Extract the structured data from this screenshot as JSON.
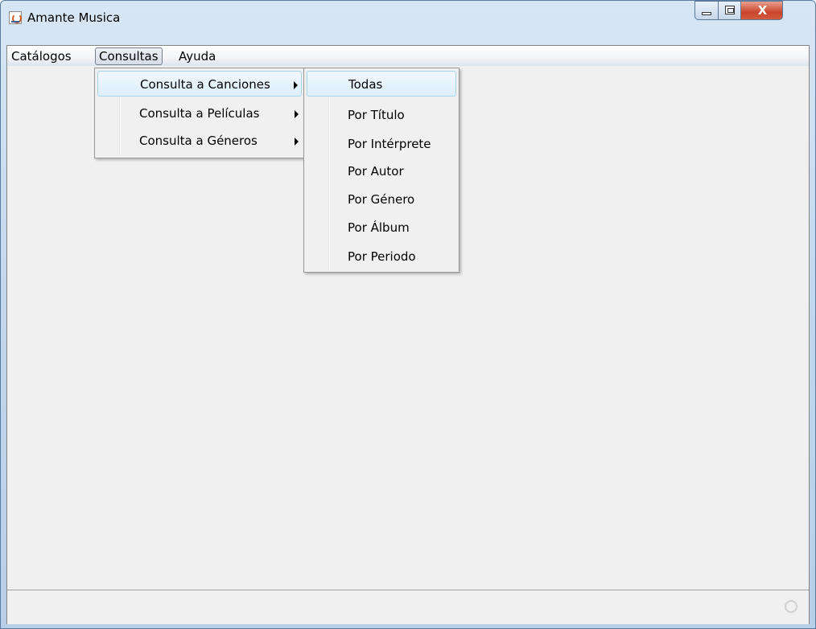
{
  "window": {
    "title": "Amante Musica",
    "close_glyph": "X",
    "icons": {
      "app": "java-icon",
      "minimize": "minimize-icon",
      "maximize": "maximize-icon",
      "close": "close-icon"
    }
  },
  "menubar": {
    "items": [
      {
        "label": "Catálogos"
      },
      {
        "label": "Consultas",
        "active": true
      },
      {
        "label": "Ayuda"
      }
    ]
  },
  "consultas_menu": {
    "items": [
      {
        "label": "Consulta a Canciones",
        "has_submenu": true,
        "highlighted": true
      },
      {
        "label": "Consulta a Películas",
        "has_submenu": true
      },
      {
        "label": "Consulta a Géneros",
        "has_submenu": true
      }
    ]
  },
  "canciones_submenu": {
    "items": [
      {
        "label": "Todas",
        "highlighted": true
      },
      {
        "label": "Por Título"
      },
      {
        "label": "Por Intérprete"
      },
      {
        "label": "Por Autor"
      },
      {
        "label": "Por Género"
      },
      {
        "label": "Por Álbum"
      },
      {
        "label": "Por Periodo"
      }
    ]
  },
  "colors": {
    "highlight_border": "#a8d3ec",
    "highlight_fill": "#dceffb",
    "close_button": "#c9452c",
    "client_background": "#f0f0f0"
  }
}
